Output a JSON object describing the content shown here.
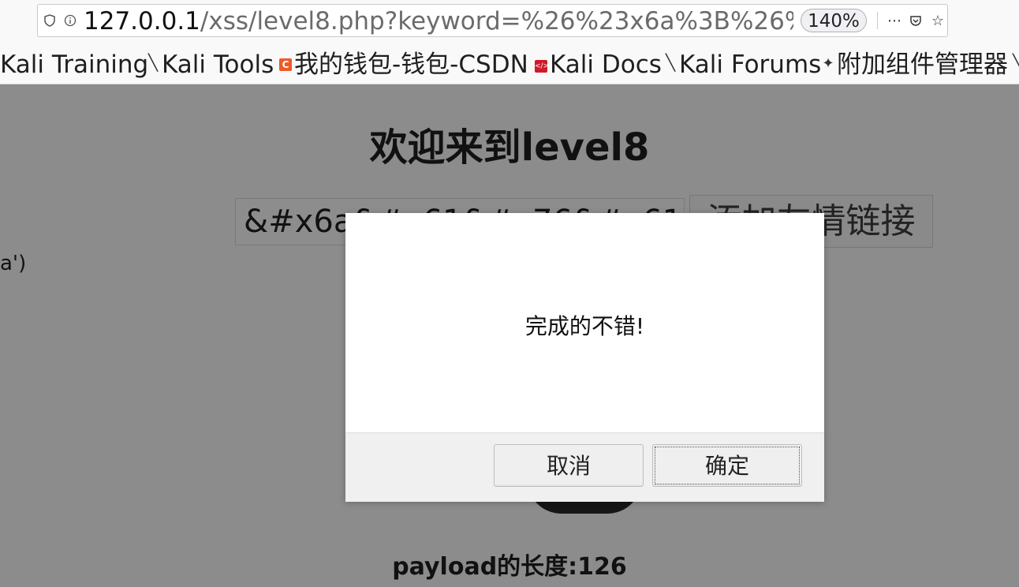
{
  "browser": {
    "url": {
      "host": "127.0.0.1",
      "rest": "/xss/level8.php?keyword=%26%23x6a%3B%26%2",
      "shield_icon": "shield-icon",
      "info_icon": "info-icon"
    },
    "zoom": "140%",
    "actions": {
      "more": "⋯",
      "pocket": "▿",
      "star": "☆"
    }
  },
  "bookmarks": [
    {
      "label": "Kali Training",
      "icon": "none"
    },
    {
      "label": "Kali Tools",
      "icon": "knife-icon"
    },
    {
      "label": "我的钱包-钱包-CSDN",
      "icon": "csdn-icon"
    },
    {
      "label": "Kali Docs",
      "icon": "docs-icon"
    },
    {
      "label": "Kali Forums",
      "icon": "knife-icon"
    },
    {
      "label": "附加组件管理器",
      "icon": "puzzle-icon"
    }
  ],
  "page": {
    "heading": "欢迎来到level8",
    "keyword_value": "&#x6a&#x61&#x76&#x61",
    "submit_label": "添加友情链接",
    "side_text": "a')",
    "payload_length": "payload的长度:126"
  },
  "dialog": {
    "message": "完成的不错!",
    "cancel_label": "取消",
    "ok_label": "确定"
  }
}
